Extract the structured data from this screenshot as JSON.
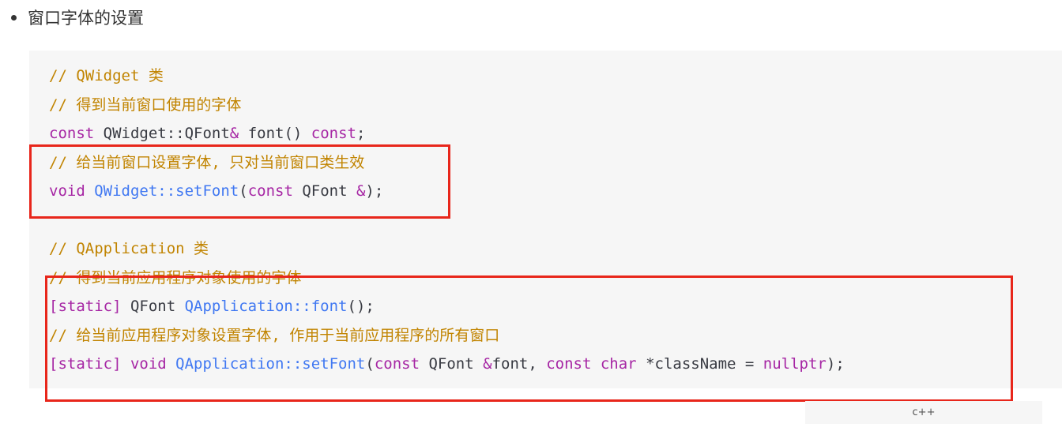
{
  "heading": "窗口字体的设置",
  "code_lines": [
    {
      "tokens": [
        {
          "t": "// QWidget 类",
          "c": "comment"
        }
      ]
    },
    {
      "tokens": [
        {
          "t": "// 得到当前窗口使用的字体",
          "c": "comment"
        }
      ]
    },
    {
      "tokens": [
        {
          "t": "const",
          "c": "kw"
        },
        {
          "t": " QWidget::QFont",
          "c": "plain"
        },
        {
          "t": "&",
          "c": "kw"
        },
        {
          "t": " font",
          "c": "plain"
        },
        {
          "t": "()",
          "c": "plain"
        },
        {
          "t": " const",
          "c": "kw"
        },
        {
          "t": ";",
          "c": "plain"
        }
      ]
    },
    {
      "tokens": [
        {
          "t": "// 给当前窗口设置字体, 只对当前窗口类生效",
          "c": "comment"
        }
      ]
    },
    {
      "tokens": [
        {
          "t": "void",
          "c": "kw"
        },
        {
          "t": " QWidget::setFont",
          "c": "func"
        },
        {
          "t": "(",
          "c": "plain"
        },
        {
          "t": "const",
          "c": "kw"
        },
        {
          "t": " QFont ",
          "c": "plain"
        },
        {
          "t": "&",
          "c": "kw"
        },
        {
          "t": ");",
          "c": "plain"
        }
      ]
    },
    {
      "blank": true
    },
    {
      "tokens": [
        {
          "t": "// QApplication 类",
          "c": "comment"
        }
      ]
    },
    {
      "tokens": [
        {
          "t": "// 得到当前应用程序对象使用的字体",
          "c": "comment"
        }
      ]
    },
    {
      "tokens": [
        {
          "t": "[static]",
          "c": "kw"
        },
        {
          "t": " QFont ",
          "c": "plain"
        },
        {
          "t": "QApplication::font",
          "c": "func"
        },
        {
          "t": "();",
          "c": "plain"
        }
      ]
    },
    {
      "tokens": [
        {
          "t": "// 给当前应用程序对象设置字体, 作用于当前应用程序的所有窗口",
          "c": "comment"
        }
      ]
    },
    {
      "tokens": [
        {
          "t": "[static]",
          "c": "kw"
        },
        {
          "t": " void",
          "c": "kw"
        },
        {
          "t": " QApplication::setFont",
          "c": "func"
        },
        {
          "t": "(",
          "c": "plain"
        },
        {
          "t": "const",
          "c": "kw"
        },
        {
          "t": " QFont ",
          "c": "plain"
        },
        {
          "t": "&",
          "c": "kw"
        },
        {
          "t": "font, ",
          "c": "plain"
        },
        {
          "t": "const",
          "c": "kw"
        },
        {
          "t": " char",
          "c": "kw"
        },
        {
          "t": " *",
          "c": "plain"
        },
        {
          "t": "className ",
          "c": "plain"
        },
        {
          "t": "=",
          "c": "plain"
        },
        {
          "t": " nullptr",
          "c": "kw"
        },
        {
          "t": ");",
          "c": "plain"
        }
      ]
    }
  ],
  "language_label": "c++",
  "colors": {
    "highlight_border": "#e8261b",
    "code_background": "#f6f6f6",
    "comment": "#c18401",
    "keyword": "#a626a4",
    "function": "#4078f2"
  }
}
